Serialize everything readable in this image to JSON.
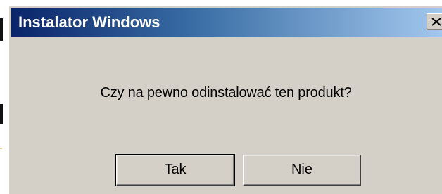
{
  "window": {
    "title": "Instalator Windows",
    "title_gradient": [
      "#0a246a",
      "#a6caf0"
    ],
    "background": "#d4d0c8"
  },
  "message": "Czy na pewno odinstalować ten produkt?",
  "buttons": {
    "yes_label": "Tak",
    "no_label": "Nie"
  },
  "icons": {
    "close": "close-icon"
  }
}
